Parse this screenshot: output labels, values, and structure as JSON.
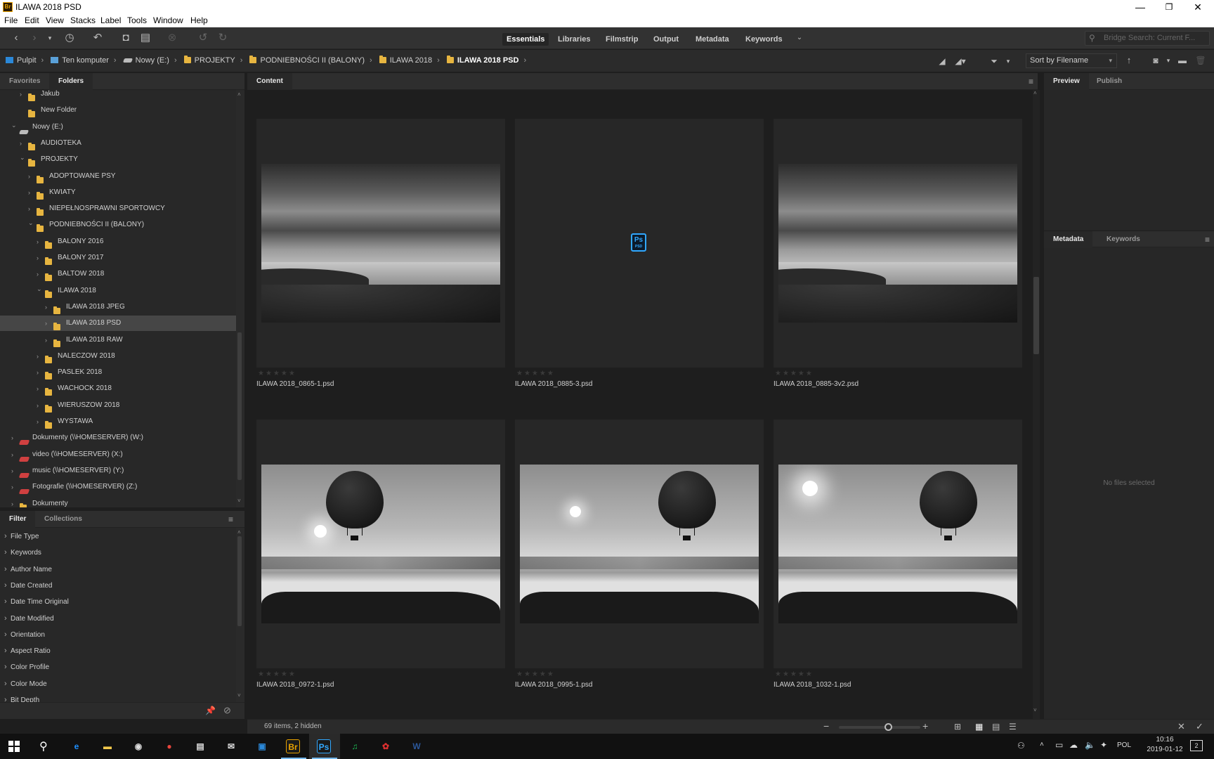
{
  "window": {
    "title": "ILAWA 2018 PSD",
    "app_icon": "Br",
    "min_glyph": "—",
    "max_glyph": "❐",
    "close_glyph": "✕"
  },
  "menu": [
    "File",
    "Edit",
    "View",
    "Stacks",
    "Label",
    "Tools",
    "Window",
    "Help"
  ],
  "workspaces": [
    "Essentials",
    "Libraries",
    "Filmstrip",
    "Output",
    "Metadata",
    "Keywords"
  ],
  "search_placeholder": "Bridge Search: Current F...",
  "breadcrumbs": [
    "Pulpit",
    "Ten komputer",
    "Nowy (E:)",
    "PROJEKTY",
    "PODNIEBNOŚCI II (BALONY)",
    "ILAWA 2018",
    "ILAWA 2018 PSD"
  ],
  "sort": {
    "label": "Sort by Filename"
  },
  "left_tabs": [
    "Favorites",
    "Folders"
  ],
  "folders": [
    {
      "label": "Jakub",
      "kind": "folder",
      "depth": 2,
      "chevron": "right"
    },
    {
      "label": "New Folder",
      "kind": "folder",
      "depth": 2,
      "chevron": ""
    },
    {
      "label": "Nowy (E:)",
      "kind": "drive",
      "depth": 1,
      "chevron": "down"
    },
    {
      "label": "AUDIOTEKA",
      "kind": "folder",
      "depth": 2,
      "chevron": "right"
    },
    {
      "label": "PROJEKTY",
      "kind": "folder",
      "depth": 2,
      "chevron": "down"
    },
    {
      "label": "ADOPTOWANE PSY",
      "kind": "folder",
      "depth": 3,
      "chevron": "right"
    },
    {
      "label": "KWIATY",
      "kind": "folder",
      "depth": 3,
      "chevron": "right"
    },
    {
      "label": "NIEPEŁNOSPRAWNI SPORTOWCY",
      "kind": "folder",
      "depth": 3,
      "chevron": "right"
    },
    {
      "label": "PODNIEBNOŚCI II (BALONY)",
      "kind": "folder",
      "depth": 3,
      "chevron": "down"
    },
    {
      "label": "BALONY 2016",
      "kind": "folder",
      "depth": 4,
      "chevron": "right"
    },
    {
      "label": "BALONY 2017",
      "kind": "folder",
      "depth": 4,
      "chevron": "right"
    },
    {
      "label": "BALTOW 2018",
      "kind": "folder",
      "depth": 4,
      "chevron": "right"
    },
    {
      "label": "ILAWA 2018",
      "kind": "folder",
      "depth": 4,
      "chevron": "down"
    },
    {
      "label": "ILAWA 2018 JPEG",
      "kind": "folder",
      "depth": 5,
      "chevron": "right"
    },
    {
      "label": "ILAWA 2018 PSD",
      "kind": "folder",
      "depth": 5,
      "chevron": "right",
      "selected": true
    },
    {
      "label": "ILAWA 2018 RAW",
      "kind": "folder",
      "depth": 5,
      "chevron": "right"
    },
    {
      "label": "NALECZOW 2018",
      "kind": "folder",
      "depth": 4,
      "chevron": "right"
    },
    {
      "label": "PASLEK 2018",
      "kind": "folder",
      "depth": 4,
      "chevron": "right"
    },
    {
      "label": "WACHOCK 2018",
      "kind": "folder",
      "depth": 4,
      "chevron": "right"
    },
    {
      "label": "WIERUSZOW 2018",
      "kind": "folder",
      "depth": 4,
      "chevron": "right"
    },
    {
      "label": "WYSTAWA",
      "kind": "folder",
      "depth": 4,
      "chevron": "right"
    },
    {
      "label": "Dokumenty (\\\\HOMESERVER) (W:)",
      "kind": "netdrive",
      "depth": 1,
      "chevron": "right"
    },
    {
      "label": "video (\\\\HOMESERVER) (X:)",
      "kind": "netdrive",
      "depth": 1,
      "chevron": "right"
    },
    {
      "label": "music (\\\\HOMESERVER) (Y:)",
      "kind": "netdrive",
      "depth": 1,
      "chevron": "right"
    },
    {
      "label": "Fotografie (\\\\HOMESERVER) (Z:)",
      "kind": "netdrive",
      "depth": 1,
      "chevron": "right"
    },
    {
      "label": "Dokumenty",
      "kind": "folder",
      "depth": 1,
      "chevron": "right"
    }
  ],
  "filter_tabs": [
    "Filter",
    "Collections"
  ],
  "filters": [
    "File Type",
    "Keywords",
    "Author Name",
    "Date Created",
    "Date Time Original",
    "Date Modified",
    "Orientation",
    "Aspect Ratio",
    "Color Profile",
    "Color Mode",
    "Bit Depth"
  ],
  "content_tab": "Content",
  "thumbnails": [
    {
      "filename": "ILAWA 2018_0865-1.psd",
      "image": "lake-sky"
    },
    {
      "filename": "ILAWA 2018_0885-3.psd",
      "image": "psd-icon"
    },
    {
      "filename": "ILAWA 2018_0885-3v2.psd",
      "image": "lake-sky"
    },
    {
      "filename": "ILAWA 2018_0972-1.psd",
      "image": "balloon-left-sun"
    },
    {
      "filename": "ILAWA 2018_0995-1.psd",
      "image": "balloon-right"
    },
    {
      "filename": "ILAWA 2018_1032-1.psd",
      "image": "balloon-right-sun"
    }
  ],
  "psd_icon": {
    "line1": "Ps",
    "line2": "PSD",
    "color": "#31a8ff"
  },
  "rating_stars": "★★★★★",
  "right_tabs_top": [
    "Preview",
    "Publish"
  ],
  "right_tabs_bottom": [
    "Metadata",
    "Keywords"
  ],
  "no_selection": "No files selected",
  "status": {
    "items": "69 items, 2 hidden",
    "zoom_minus": "−",
    "zoom_plus": "+",
    "thumbnail_size": 0.6
  },
  "taskbar": {
    "apps": [
      {
        "name": "edge",
        "glyph": "e",
        "color": "#1e90ff"
      },
      {
        "name": "file-explorer",
        "glyph": "▬",
        "color": "#f2c94c"
      },
      {
        "name": "camera",
        "glyph": "◉",
        "color": "#dddddd"
      },
      {
        "name": "chrome",
        "glyph": "●",
        "color": "#e8453c"
      },
      {
        "name": "store",
        "glyph": "▤",
        "color": "#dddddd"
      },
      {
        "name": "mail",
        "glyph": "✉",
        "color": "#dddddd"
      },
      {
        "name": "photos",
        "glyph": "▣",
        "color": "#2b88d8"
      },
      {
        "name": "bridge",
        "glyph": "Br",
        "color": "#e8a200"
      },
      {
        "name": "photoshop",
        "glyph": "Ps",
        "color": "#31a8ff"
      },
      {
        "name": "spotify",
        "glyph": "♫",
        "color": "#1db954"
      },
      {
        "name": "acrobat",
        "glyph": "✿",
        "color": "#e03030"
      },
      {
        "name": "word",
        "glyph": "W",
        "color": "#2b579a"
      }
    ],
    "lang": "POL",
    "time": "10:16",
    "date": "2019-01-12",
    "notifications": "2"
  }
}
